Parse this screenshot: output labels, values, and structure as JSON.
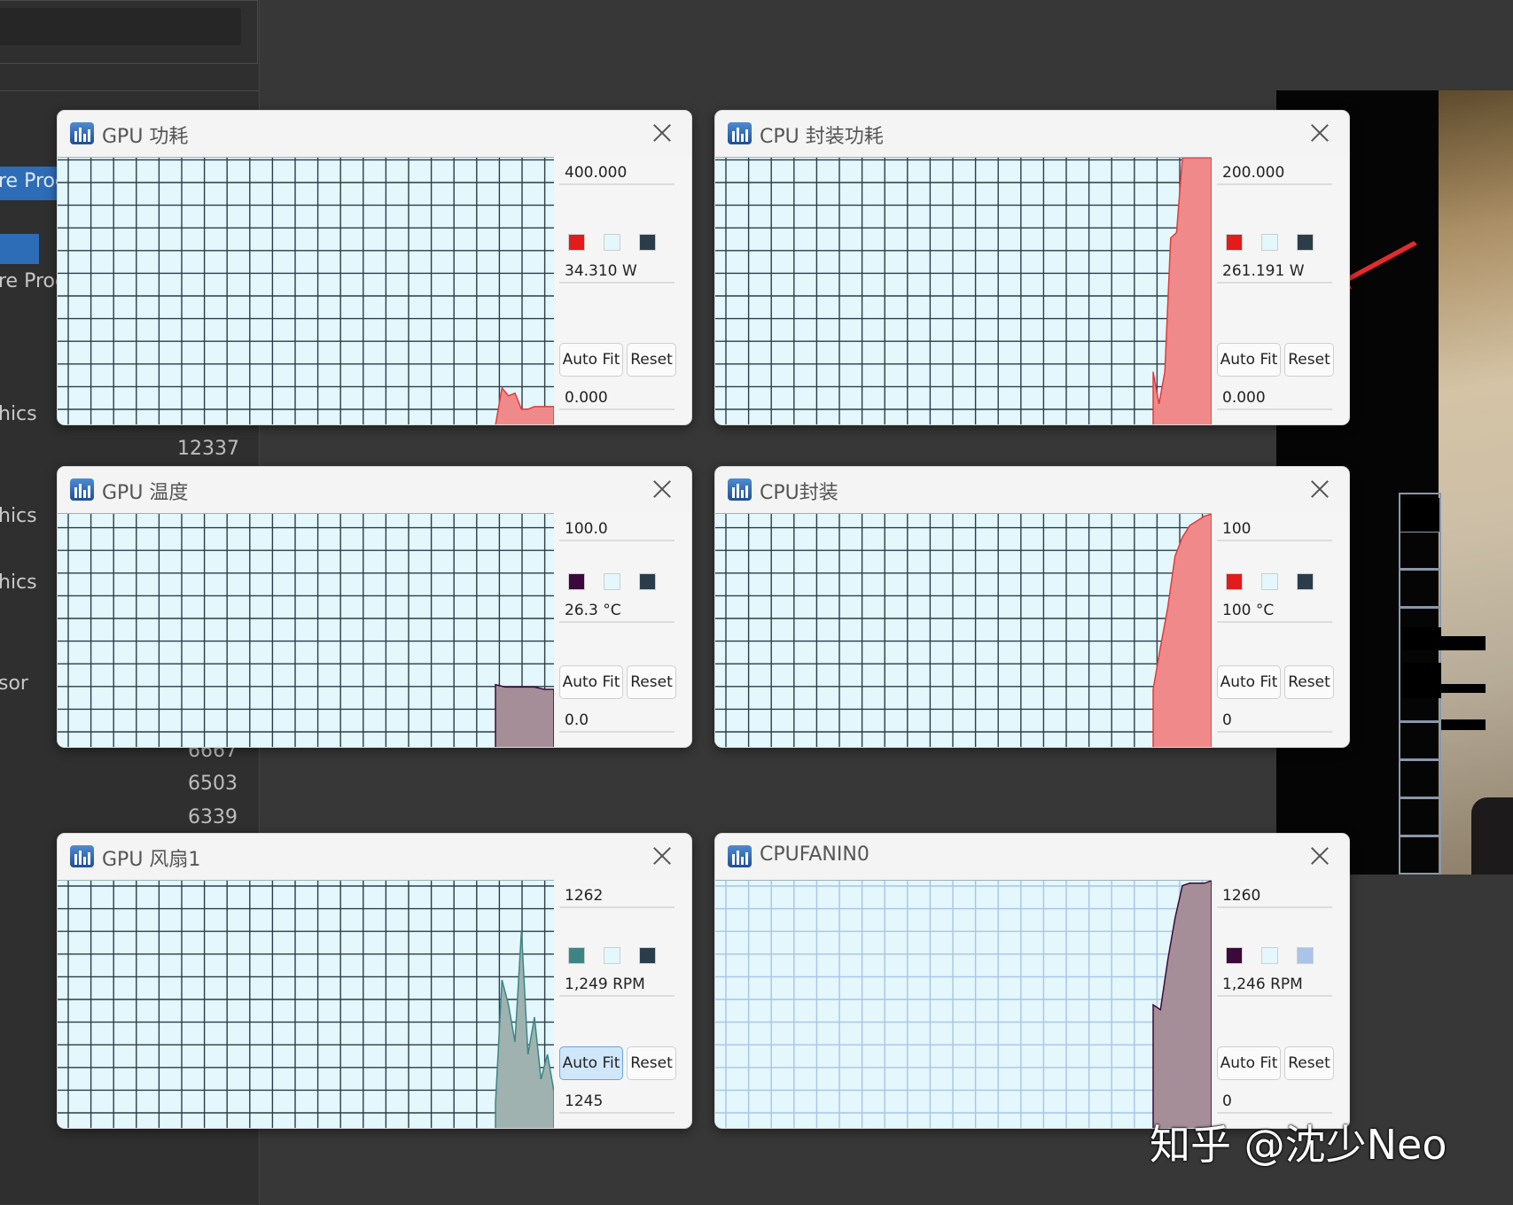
{
  "background_app": {
    "items": [
      "re Proc",
      "re Proc",
      "hics",
      "hics",
      "hics",
      "sor"
    ],
    "numbers": [
      "12337",
      "6667",
      "6503",
      "6339"
    ]
  },
  "watermark": "知乎 @沈少Neo",
  "colors": {
    "grid_bg": "#e3f7fc",
    "grid_line_dark": "#2b3d4a",
    "grid_line_light": "#a9c4e6"
  },
  "windows": [
    {
      "title": "GPU 功耗",
      "max": "400.000",
      "current": "34.310 W",
      "min": "0.000",
      "auto_fit": "Auto Fit",
      "reset": "Reset",
      "swatches": [
        "#e31b1b",
        "#e3f7fc",
        "#2b3d4a"
      ],
      "icon": "monitor-app-icon",
      "fill": "#f08a8a",
      "stroke": "#e33a3a",
      "grid": "#2b3d4a",
      "autofit_active": false,
      "history": [
        0,
        0.14,
        0.11,
        0.12,
        0.06,
        0.06,
        0.07,
        0.07,
        0.07,
        0.07
      ]
    },
    {
      "title": "CPU 封装功耗",
      "max": "200.000",
      "current": "261.191 W",
      "min": "0.000",
      "auto_fit": "Auto Fit",
      "reset": "Reset",
      "swatches": [
        "#e31b1b",
        "#e3f7fc",
        "#2b3d4a"
      ],
      "icon": "monitor-app-icon",
      "fill": "#f08a8a",
      "stroke": "#e33a3a",
      "grid": "#2b3d4a",
      "autofit_active": false,
      "history": [
        0.2,
        0.08,
        0.2,
        0.7,
        0.72,
        1,
        1,
        1,
        1,
        1,
        1
      ]
    },
    {
      "title": "GPU 温度",
      "max": "100.0",
      "current": "26.3 °C",
      "min": "0.0",
      "auto_fit": "Auto Fit",
      "reset": "Reset",
      "swatches": [
        "#3a0a3a",
        "#e3f7fc",
        "#2b3d4a"
      ],
      "icon": "monitor-app-icon",
      "fill": "#a68e98",
      "stroke": "#3a0a3a",
      "grid": "#2b3d4a",
      "autofit_active": false,
      "history": [
        0.27,
        0.26,
        0.26,
        0.26,
        0.26,
        0.25,
        0.25
      ]
    },
    {
      "title": "CPU封装",
      "max": "100",
      "current": "100 °C",
      "min": "0",
      "auto_fit": "Auto Fit",
      "reset": "Reset",
      "swatches": [
        "#e31b1b",
        "#e3f7fc",
        "#2b3d4a"
      ],
      "icon": "monitor-app-icon",
      "fill": "#f08a8a",
      "stroke": "#e33a3a",
      "grid": "#2b3d4a",
      "autofit_active": false,
      "history": [
        0.25,
        0.43,
        0.6,
        0.82,
        0.9,
        0.95,
        0.97,
        0.99,
        1
      ]
    },
    {
      "title": "GPU 风扇1",
      "max": "1262",
      "current": "1,249 RPM",
      "min": "1245",
      "auto_fit": "Auto Fit",
      "reset": "Reset",
      "swatches": [
        "#3d8585",
        "#e3f7fc",
        "#2b3d4a"
      ],
      "icon": "monitor-app-icon",
      "fill": "#9fb2b0",
      "stroke": "#3d8585",
      "grid": "#2b3d4a",
      "autofit_active": true,
      "history": [
        0.1,
        0.6,
        0.5,
        0.35,
        0.8,
        0.3,
        0.45,
        0.2,
        0.3,
        0.15
      ]
    },
    {
      "title": "CPUFANIN0",
      "max": "1260",
      "current": "1,246 RPM",
      "min": "0",
      "auto_fit": "Auto Fit",
      "reset": "Reset",
      "swatches": [
        "#3a0a3a",
        "#e3f7fc",
        "#a9c4e6"
      ],
      "icon": "monitor-app-icon",
      "fill": "#a68e98",
      "stroke": "#3a0a3a",
      "grid": "#a9c4e6",
      "autofit_active": false,
      "history": [
        0.5,
        0.48,
        0.68,
        0.85,
        0.98,
        0.99,
        0.99,
        0.99,
        1
      ]
    }
  ]
}
